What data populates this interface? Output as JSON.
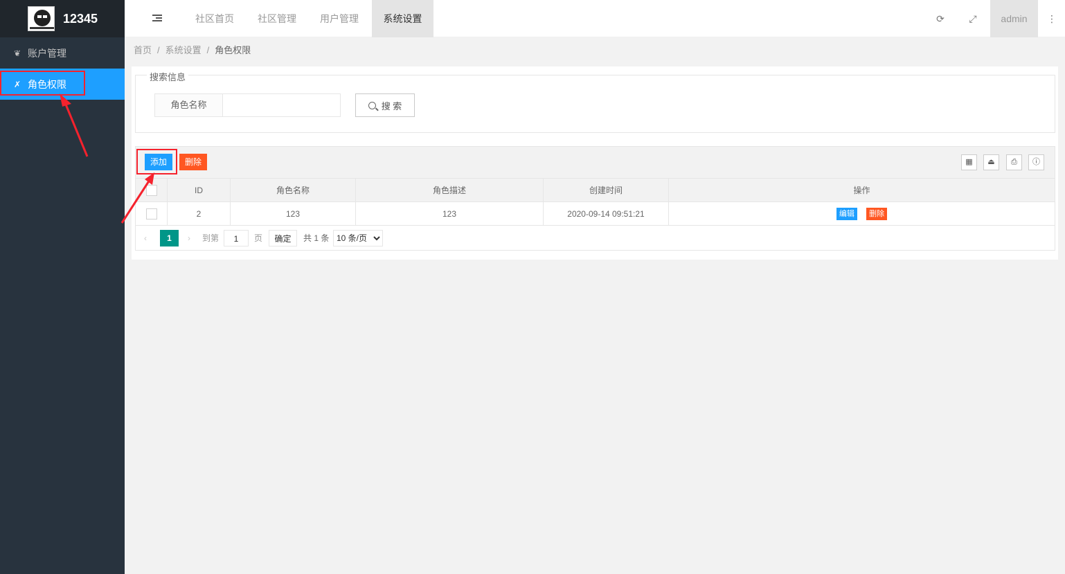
{
  "app": {
    "title": "12345"
  },
  "sidebar": {
    "items": [
      {
        "label": "账户管理",
        "icon": "leaf-icon",
        "active": false
      },
      {
        "label": "角色权限",
        "icon": "x-mark-icon",
        "active": true
      }
    ]
  },
  "header": {
    "tabs": [
      {
        "label": "社区首页",
        "active": false
      },
      {
        "label": "社区管理",
        "active": false
      },
      {
        "label": "用户管理",
        "active": false
      },
      {
        "label": "系统设置",
        "active": true
      }
    ],
    "user": "admin"
  },
  "breadcrumb": {
    "home": "首页",
    "section": "系统设置",
    "current": "角色权限",
    "separator": "/"
  },
  "search": {
    "legend": "搜索信息",
    "field_label": "角色名称",
    "field_value": "",
    "field_placeholder": "",
    "button_label": "搜 索"
  },
  "toolbar": {
    "add_label": "添加",
    "delete_label": "删除"
  },
  "table": {
    "columns": [
      "ID",
      "角色名称",
      "角色描述",
      "创建时间",
      "操作"
    ],
    "rows": [
      {
        "id": "2",
        "name": "123",
        "description": "123",
        "created": "2020-09-14 09:51:21"
      }
    ],
    "row_actions": {
      "edit": "编辑",
      "delete": "删除"
    }
  },
  "pagination": {
    "current_page": "1",
    "goto_label": "到第",
    "goto_value": "1",
    "page_suffix": "页",
    "confirm_label": "确定",
    "total_label": "共 1 条",
    "page_size": "10 条/页"
  },
  "colors": {
    "accent": "#1e9fff",
    "danger": "#ff5722",
    "sidebar_bg": "#28333e",
    "pager_active": "#009688",
    "annotation": "#f5222d"
  }
}
